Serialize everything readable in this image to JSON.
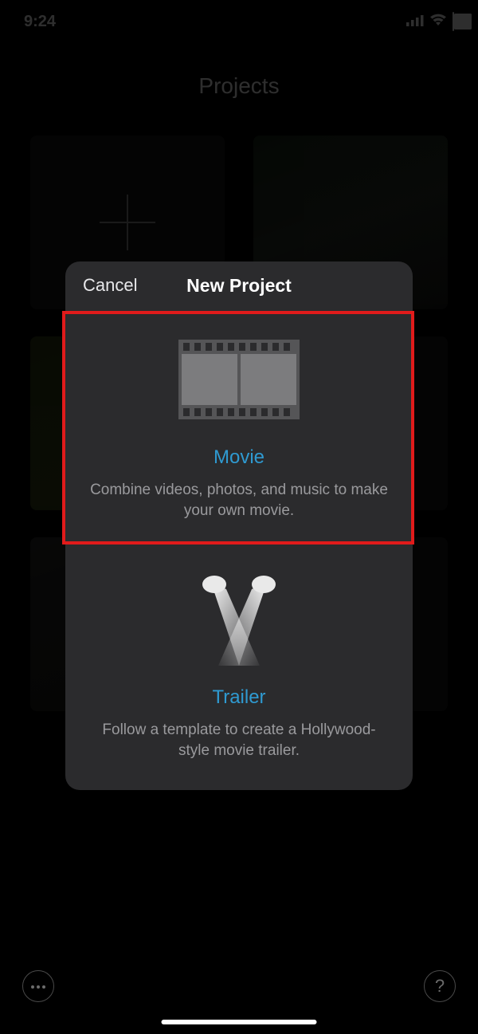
{
  "status": {
    "time": "9:24"
  },
  "page": {
    "title": "Projects"
  },
  "modal": {
    "cancel": "Cancel",
    "title": "New Project",
    "options": {
      "movie": {
        "title": "Movie",
        "desc": "Combine videos, photos, and music to make your own movie."
      },
      "trailer": {
        "title": "Trailer",
        "desc": "Follow a template to create a Hollywood-style movie trailer."
      }
    }
  }
}
